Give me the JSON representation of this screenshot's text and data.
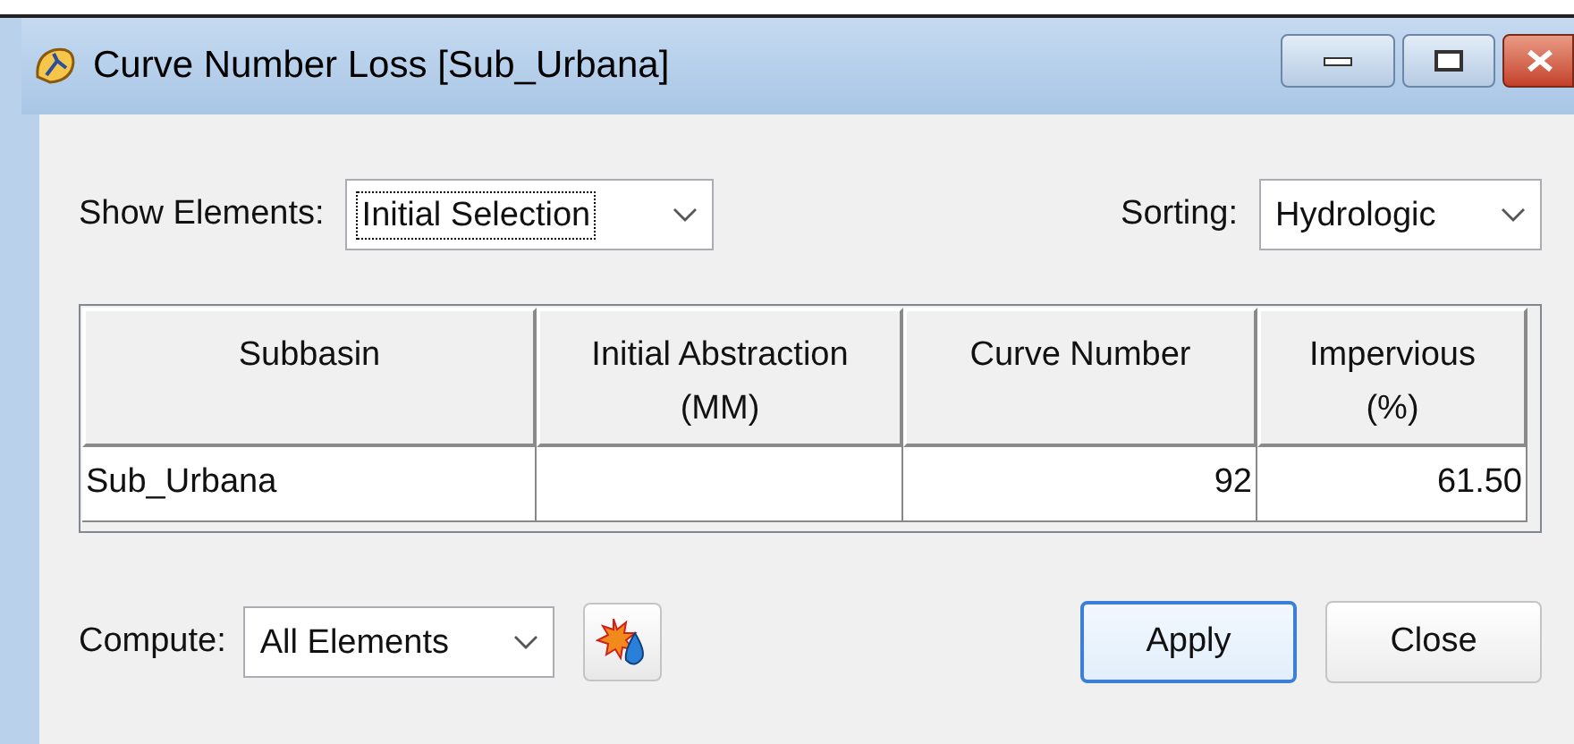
{
  "window": {
    "title": "Curve Number Loss [Sub_Urbana]"
  },
  "show_elements": {
    "label": "Show Elements:",
    "value": "Initial Selection",
    "focused": true
  },
  "sorting": {
    "label": "Sorting:",
    "value": "Hydrologic",
    "focused": false
  },
  "table": {
    "columns": [
      {
        "label": "Subbasin"
      },
      {
        "label": "Initial Abstraction",
        "sub": "(MM)"
      },
      {
        "label": "Curve Number"
      },
      {
        "label": "Impervious",
        "sub": "(%)"
      }
    ],
    "rows": [
      {
        "cells": [
          "Sub_Urbana",
          "",
          "92",
          "61.50"
        ]
      }
    ]
  },
  "compute": {
    "label": "Compute:",
    "value": "All Elements",
    "focused": false
  },
  "buttons": [
    {
      "label": "Apply",
      "default": true
    },
    {
      "label": "Close",
      "default": false
    }
  ]
}
